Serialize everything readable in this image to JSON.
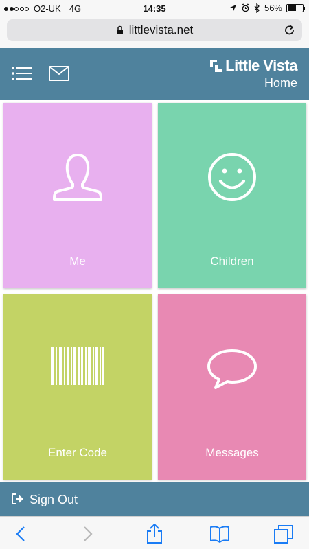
{
  "status_bar": {
    "carrier": "O2-UK",
    "network": "4G",
    "time": "14:35",
    "battery": "56%",
    "battery_level": 0.56,
    "signal_bars_filled": 2,
    "signal_bars_total": 5
  },
  "browser": {
    "url": "littlevista.net"
  },
  "header": {
    "brand": "Little Vista",
    "page_title": "Home"
  },
  "tiles": [
    {
      "label": "Me",
      "icon": "person-icon",
      "color": "#e8b0ef"
    },
    {
      "label": "Children",
      "icon": "smiley-icon",
      "color": "#79d4ae"
    },
    {
      "label": "Enter Code",
      "icon": "barcode-icon",
      "color": "#c3d365"
    },
    {
      "label": "Messages",
      "icon": "speech-bubble-icon",
      "color": "#e889b3"
    }
  ],
  "signout": {
    "label": "Sign Out"
  },
  "colors": {
    "header": "#4f829d",
    "browser_accent": "#1a7cf5"
  }
}
